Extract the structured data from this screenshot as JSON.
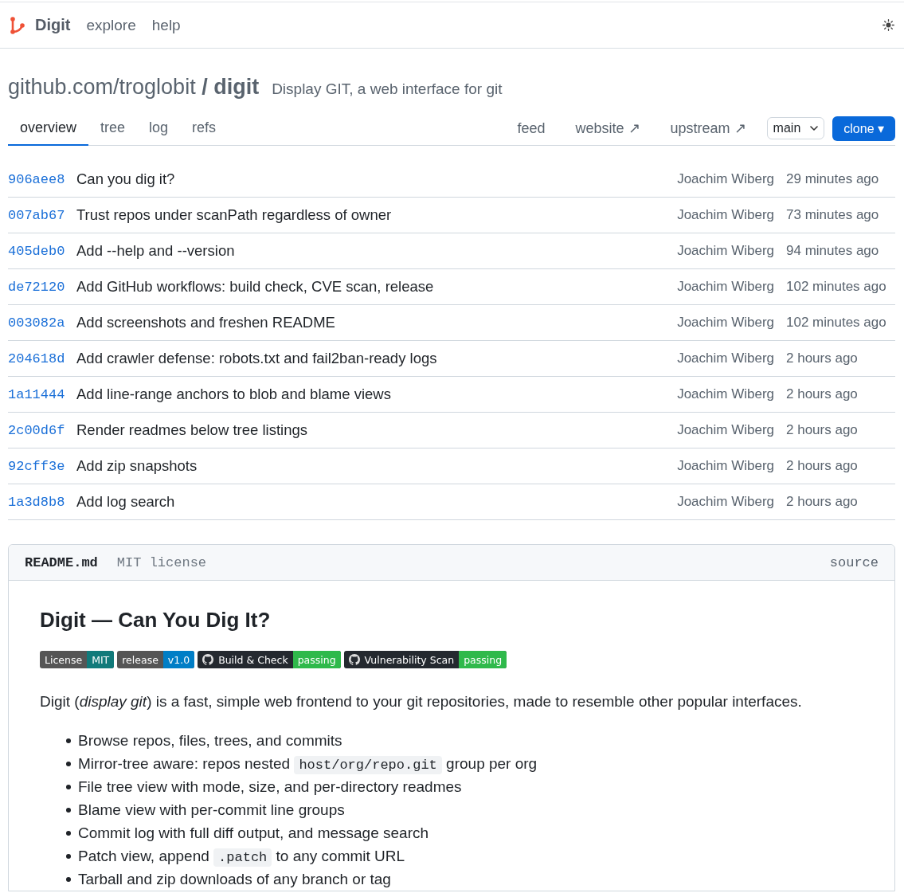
{
  "header": {
    "brand": "Digit",
    "nav": [
      {
        "label": "explore"
      },
      {
        "label": "help"
      }
    ]
  },
  "repo": {
    "title": "github.com/troglobit **/ digit**",
    "description": "Display GIT, a web interface for git"
  },
  "tabs": [
    {
      "label": "overview",
      "selected": true
    },
    {
      "label": "tree",
      "selected": false
    },
    {
      "label": "log",
      "selected": false
    },
    {
      "label": "refs",
      "selected": false
    }
  ],
  "links": [
    {
      "label": "feed"
    },
    {
      "label": "website ↗"
    },
    {
      "label": "upstream ↗"
    }
  ],
  "branch_select": {
    "value": "main"
  },
  "clone_button": {
    "label": "clone ▾"
  },
  "commits": [
    {
      "hash": "906aee8",
      "message": "Can you dig it?",
      "author": "Joachim Wiberg",
      "time": "29 minutes ago"
    },
    {
      "hash": "007ab67",
      "message": "Trust repos under scanPath regardless of owner",
      "author": "Joachim Wiberg",
      "time": "73 minutes ago"
    },
    {
      "hash": "405deb0",
      "message": "Add --help and --version",
      "author": "Joachim Wiberg",
      "time": "94 minutes ago"
    },
    {
      "hash": "de72120",
      "message": "Add GitHub workflows: build check, CVE scan, release",
      "author": "Joachim Wiberg",
      "time": "102 minutes ago"
    },
    {
      "hash": "003082a",
      "message": "Add screenshots and freshen README",
      "author": "Joachim Wiberg",
      "time": "102 minutes ago"
    },
    {
      "hash": "204618d",
      "message": "Add crawler defense: robots.txt and fail2ban-ready logs",
      "author": "Joachim Wiberg",
      "time": "2 hours ago"
    },
    {
      "hash": "1a11444",
      "message": "Add line-range anchors to blob and blame views",
      "author": "Joachim Wiberg",
      "time": "2 hours ago"
    },
    {
      "hash": "2c00d6f",
      "message": "Render readmes below tree listings",
      "author": "Joachim Wiberg",
      "time": "2 hours ago"
    },
    {
      "hash": "92cff3e",
      "message": "Add zip snapshots",
      "author": "Joachim Wiberg",
      "time": "2 hours ago"
    },
    {
      "hash": "1a3d8b8",
      "message": "Add log search",
      "author": "Joachim Wiberg",
      "time": "2 hours ago"
    }
  ],
  "readme": {
    "filename": "README.md",
    "license": "MIT license",
    "source_link": "source",
    "heading": "Digit — Can You Dig It?",
    "badges": [
      {
        "kind": "shield",
        "label": "License",
        "value": "MIT",
        "color": "#117a7a"
      },
      {
        "kind": "shield",
        "label": "release",
        "value": "v1.0",
        "color": "#007ec6"
      },
      {
        "kind": "github",
        "label": "Build & Check",
        "value": "passing",
        "color": "#2fb94b"
      },
      {
        "kind": "github",
        "label": "Vulnerability Scan",
        "value": "passing",
        "color": "#2fb94b"
      }
    ],
    "intro": "Digit (*display git*) is a fast, simple web frontend to your git repositories, made to resemble other popular interfaces.",
    "features": [
      {
        "parts": [
          {
            "kind": "text",
            "text": "Browse repos, files, trees, and commits"
          }
        ]
      },
      {
        "parts": [
          {
            "kind": "text",
            "text": "Mirror-tree aware: repos nested "
          },
          {
            "kind": "code",
            "text": "host/org/repo.git"
          },
          {
            "kind": "text",
            "text": " group per org"
          }
        ]
      },
      {
        "parts": [
          {
            "kind": "text",
            "text": "File tree view with mode, size, and per-directory readmes"
          }
        ]
      },
      {
        "parts": [
          {
            "kind": "text",
            "text": "Blame view with per-commit line groups"
          }
        ]
      },
      {
        "parts": [
          {
            "kind": "text",
            "text": "Commit log with full diff output, and message search"
          }
        ]
      },
      {
        "parts": [
          {
            "kind": "text",
            "text": "Patch view, append "
          },
          {
            "kind": "code",
            "text": ".patch"
          },
          {
            "kind": "text",
            "text": " to any commit URL"
          }
        ]
      },
      {
        "parts": [
          {
            "kind": "text",
            "text": "Tarball and zip downloads of any branch or tag"
          }
        ]
      }
    ]
  }
}
